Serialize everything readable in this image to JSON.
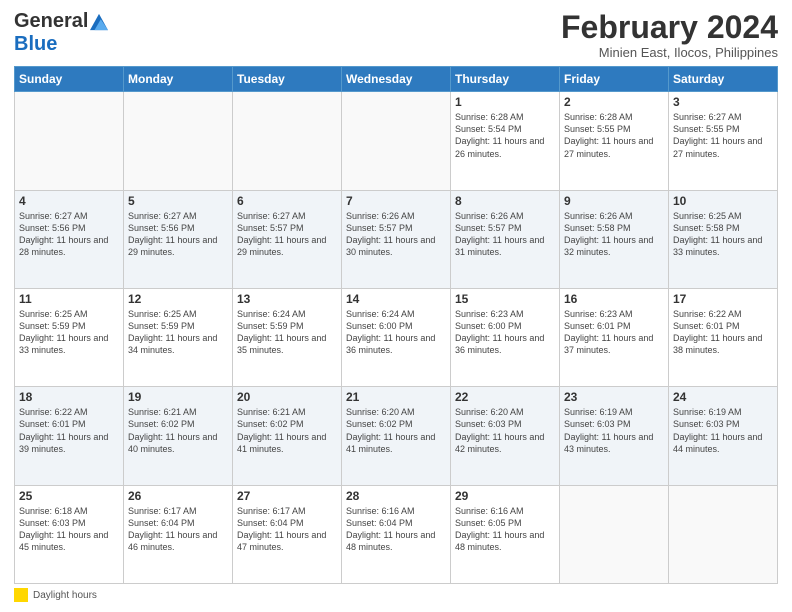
{
  "header": {
    "logo_general": "General",
    "logo_blue": "Blue",
    "month_title": "February 2024",
    "subtitle": "Minien East, Ilocos, Philippines"
  },
  "weekdays": [
    "Sunday",
    "Monday",
    "Tuesday",
    "Wednesday",
    "Thursday",
    "Friday",
    "Saturday"
  ],
  "legend": {
    "label": "Daylight hours"
  },
  "weeks": [
    [
      {
        "day": "",
        "sunrise": "",
        "sunset": "",
        "daylight": "",
        "empty": true
      },
      {
        "day": "",
        "sunrise": "",
        "sunset": "",
        "daylight": "",
        "empty": true
      },
      {
        "day": "",
        "sunrise": "",
        "sunset": "",
        "daylight": "",
        "empty": true
      },
      {
        "day": "",
        "sunrise": "",
        "sunset": "",
        "daylight": "",
        "empty": true
      },
      {
        "day": "1",
        "sunrise": "Sunrise: 6:28 AM",
        "sunset": "Sunset: 5:54 PM",
        "daylight": "Daylight: 11 hours and 26 minutes.",
        "empty": false
      },
      {
        "day": "2",
        "sunrise": "Sunrise: 6:28 AM",
        "sunset": "Sunset: 5:55 PM",
        "daylight": "Daylight: 11 hours and 27 minutes.",
        "empty": false
      },
      {
        "day": "3",
        "sunrise": "Sunrise: 6:27 AM",
        "sunset": "Sunset: 5:55 PM",
        "daylight": "Daylight: 11 hours and 27 minutes.",
        "empty": false
      }
    ],
    [
      {
        "day": "4",
        "sunrise": "Sunrise: 6:27 AM",
        "sunset": "Sunset: 5:56 PM",
        "daylight": "Daylight: 11 hours and 28 minutes.",
        "empty": false
      },
      {
        "day": "5",
        "sunrise": "Sunrise: 6:27 AM",
        "sunset": "Sunset: 5:56 PM",
        "daylight": "Daylight: 11 hours and 29 minutes.",
        "empty": false
      },
      {
        "day": "6",
        "sunrise": "Sunrise: 6:27 AM",
        "sunset": "Sunset: 5:57 PM",
        "daylight": "Daylight: 11 hours and 29 minutes.",
        "empty": false
      },
      {
        "day": "7",
        "sunrise": "Sunrise: 6:26 AM",
        "sunset": "Sunset: 5:57 PM",
        "daylight": "Daylight: 11 hours and 30 minutes.",
        "empty": false
      },
      {
        "day": "8",
        "sunrise": "Sunrise: 6:26 AM",
        "sunset": "Sunset: 5:57 PM",
        "daylight": "Daylight: 11 hours and 31 minutes.",
        "empty": false
      },
      {
        "day": "9",
        "sunrise": "Sunrise: 6:26 AM",
        "sunset": "Sunset: 5:58 PM",
        "daylight": "Daylight: 11 hours and 32 minutes.",
        "empty": false
      },
      {
        "day": "10",
        "sunrise": "Sunrise: 6:25 AM",
        "sunset": "Sunset: 5:58 PM",
        "daylight": "Daylight: 11 hours and 33 minutes.",
        "empty": false
      }
    ],
    [
      {
        "day": "11",
        "sunrise": "Sunrise: 6:25 AM",
        "sunset": "Sunset: 5:59 PM",
        "daylight": "Daylight: 11 hours and 33 minutes.",
        "empty": false
      },
      {
        "day": "12",
        "sunrise": "Sunrise: 6:25 AM",
        "sunset": "Sunset: 5:59 PM",
        "daylight": "Daylight: 11 hours and 34 minutes.",
        "empty": false
      },
      {
        "day": "13",
        "sunrise": "Sunrise: 6:24 AM",
        "sunset": "Sunset: 5:59 PM",
        "daylight": "Daylight: 11 hours and 35 minutes.",
        "empty": false
      },
      {
        "day": "14",
        "sunrise": "Sunrise: 6:24 AM",
        "sunset": "Sunset: 6:00 PM",
        "daylight": "Daylight: 11 hours and 36 minutes.",
        "empty": false
      },
      {
        "day": "15",
        "sunrise": "Sunrise: 6:23 AM",
        "sunset": "Sunset: 6:00 PM",
        "daylight": "Daylight: 11 hours and 36 minutes.",
        "empty": false
      },
      {
        "day": "16",
        "sunrise": "Sunrise: 6:23 AM",
        "sunset": "Sunset: 6:01 PM",
        "daylight": "Daylight: 11 hours and 37 minutes.",
        "empty": false
      },
      {
        "day": "17",
        "sunrise": "Sunrise: 6:22 AM",
        "sunset": "Sunset: 6:01 PM",
        "daylight": "Daylight: 11 hours and 38 minutes.",
        "empty": false
      }
    ],
    [
      {
        "day": "18",
        "sunrise": "Sunrise: 6:22 AM",
        "sunset": "Sunset: 6:01 PM",
        "daylight": "Daylight: 11 hours and 39 minutes.",
        "empty": false
      },
      {
        "day": "19",
        "sunrise": "Sunrise: 6:21 AM",
        "sunset": "Sunset: 6:02 PM",
        "daylight": "Daylight: 11 hours and 40 minutes.",
        "empty": false
      },
      {
        "day": "20",
        "sunrise": "Sunrise: 6:21 AM",
        "sunset": "Sunset: 6:02 PM",
        "daylight": "Daylight: 11 hours and 41 minutes.",
        "empty": false
      },
      {
        "day": "21",
        "sunrise": "Sunrise: 6:20 AM",
        "sunset": "Sunset: 6:02 PM",
        "daylight": "Daylight: 11 hours and 41 minutes.",
        "empty": false
      },
      {
        "day": "22",
        "sunrise": "Sunrise: 6:20 AM",
        "sunset": "Sunset: 6:03 PM",
        "daylight": "Daylight: 11 hours and 42 minutes.",
        "empty": false
      },
      {
        "day": "23",
        "sunrise": "Sunrise: 6:19 AM",
        "sunset": "Sunset: 6:03 PM",
        "daylight": "Daylight: 11 hours and 43 minutes.",
        "empty": false
      },
      {
        "day": "24",
        "sunrise": "Sunrise: 6:19 AM",
        "sunset": "Sunset: 6:03 PM",
        "daylight": "Daylight: 11 hours and 44 minutes.",
        "empty": false
      }
    ],
    [
      {
        "day": "25",
        "sunrise": "Sunrise: 6:18 AM",
        "sunset": "Sunset: 6:03 PM",
        "daylight": "Daylight: 11 hours and 45 minutes.",
        "empty": false
      },
      {
        "day": "26",
        "sunrise": "Sunrise: 6:17 AM",
        "sunset": "Sunset: 6:04 PM",
        "daylight": "Daylight: 11 hours and 46 minutes.",
        "empty": false
      },
      {
        "day": "27",
        "sunrise": "Sunrise: 6:17 AM",
        "sunset": "Sunset: 6:04 PM",
        "daylight": "Daylight: 11 hours and 47 minutes.",
        "empty": false
      },
      {
        "day": "28",
        "sunrise": "Sunrise: 6:16 AM",
        "sunset": "Sunset: 6:04 PM",
        "daylight": "Daylight: 11 hours and 48 minutes.",
        "empty": false
      },
      {
        "day": "29",
        "sunrise": "Sunrise: 6:16 AM",
        "sunset": "Sunset: 6:05 PM",
        "daylight": "Daylight: 11 hours and 48 minutes.",
        "empty": false
      },
      {
        "day": "",
        "sunrise": "",
        "sunset": "",
        "daylight": "",
        "empty": true
      },
      {
        "day": "",
        "sunrise": "",
        "sunset": "",
        "daylight": "",
        "empty": true
      }
    ]
  ]
}
